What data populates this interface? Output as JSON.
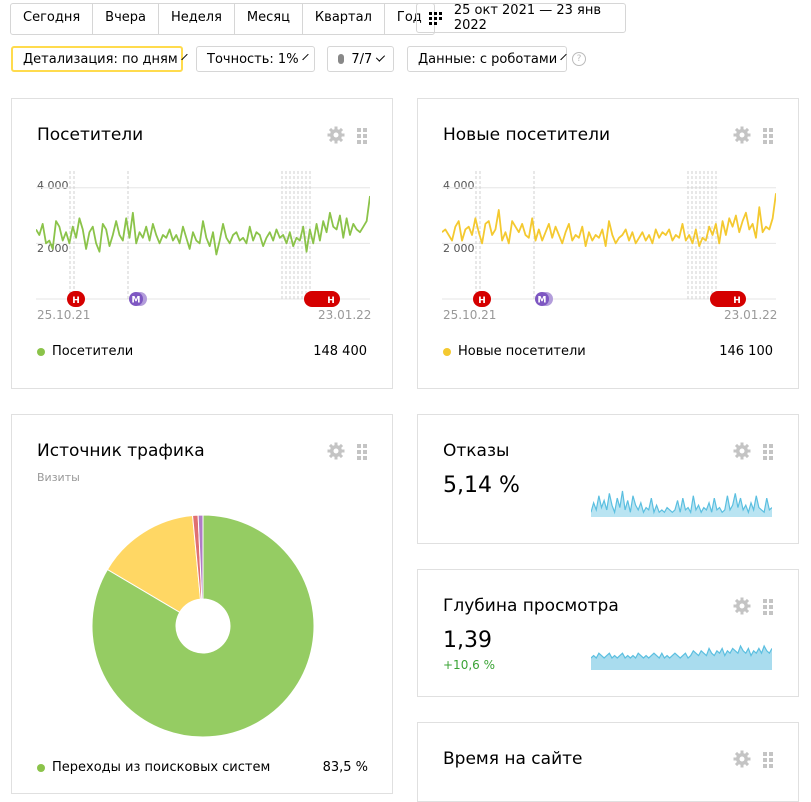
{
  "period_tabs": [
    "Сегодня",
    "Вчера",
    "Неделя",
    "Месяц",
    "Квартал",
    "Год"
  ],
  "date_range": "25 окт 2021 — 23 янв 2022",
  "toolbar": {
    "detail": "Детализация: по дням",
    "accuracy": "Точность: 1%",
    "comments": "7/7",
    "data": "Данные: с роботами",
    "help": "?"
  },
  "colors": {
    "green": "#8bc34a",
    "yellow": "#f4c930",
    "red": "#d50000",
    "purple": "#7e57c2",
    "blue": "#5bc0de"
  },
  "visitors": {
    "title": "Посетители",
    "y_ticks": [
      "4 000",
      "2 000"
    ],
    "date_start": "25.10.21",
    "date_end": "23.01.22",
    "legend": "Посетители",
    "total": "148 400"
  },
  "new_visitors": {
    "title": "Новые посетители",
    "y_ticks": [
      "4 000",
      "2 000"
    ],
    "date_start": "25.10.21",
    "date_end": "23.01.22",
    "legend": "Новые посетители",
    "total": "146 100"
  },
  "traffic": {
    "title": "Источник трафика",
    "subtitle": "Визиты",
    "legend_label": "Переходы из поисковых систем",
    "legend_value": "83,5 %"
  },
  "bounces": {
    "title": "Отказы",
    "value": "5,14 %"
  },
  "depth": {
    "title": "Глубина просмотра",
    "value": "1,39",
    "delta": "+10,6 %"
  },
  "time": {
    "title": "Время на сайте"
  },
  "markers": {
    "holiday": "Н",
    "m": "М"
  },
  "chart_data": [
    {
      "type": "line",
      "series": [
        {
          "name": "Посетители",
          "values": [
            2500,
            2300,
            2700,
            2000,
            2100,
            1800,
            2800,
            2600,
            2100,
            2400,
            2000,
            2600,
            2200,
            2900,
            2500,
            1800,
            2400,
            2600,
            2000,
            1700,
            2700,
            2500,
            1900,
            2300,
            2800,
            2300,
            2100,
            2900,
            2200,
            3100,
            2000,
            2400,
            2200,
            2600,
            2100,
            2700,
            2300,
            2000,
            2300,
            2200,
            2500,
            2100,
            2300,
            2000,
            2600,
            2200,
            1800,
            2400,
            2100,
            2000,
            2800,
            2200,
            1900,
            2400,
            1600,
            2100,
            2700,
            2200,
            2000,
            2300,
            2400,
            2100,
            2200,
            2000,
            2600,
            2100,
            2400,
            2300,
            1900,
            2200,
            2400,
            2100,
            2500,
            2200,
            2300,
            2000,
            2400,
            1900,
            2200,
            2100,
            2600,
            1700,
            2500,
            2000,
            2700,
            2100,
            2800,
            2400,
            3100,
            2600,
            2500,
            3000,
            2200,
            2900,
            2300,
            2700,
            2500,
            2400,
            2600,
            2800,
            3700
          ]
        }
      ],
      "ylim": [
        0,
        4600
      ]
    },
    {
      "type": "line",
      "series": [
        {
          "name": "Новые посетители",
          "values": [
            2400,
            2500,
            2300,
            2100,
            2600,
            2800,
            2100,
            2500,
            2600,
            2300,
            2900,
            2400,
            2000,
            2700,
            2800,
            2300,
            2500,
            3200,
            2100,
            2400,
            2000,
            2800,
            2600,
            2400,
            2700,
            2300,
            2200,
            2900,
            2100,
            2500,
            2100,
            2400,
            2700,
            2200,
            2600,
            2300,
            2000,
            2400,
            2700,
            2100,
            2300,
            2200,
            2600,
            1900,
            2400,
            2100,
            2300,
            2200,
            2500,
            1900,
            2800,
            2300,
            2000,
            2200,
            2300,
            2500,
            2100,
            2400,
            2000,
            2200,
            2400,
            2100,
            2300,
            2000,
            2500,
            2200,
            2400,
            2300,
            2500,
            2100,
            2300,
            2200,
            2700,
            2100,
            2300,
            2000,
            2500,
            1900,
            2200,
            2100,
            2600,
            2300,
            2700,
            2000,
            2800,
            2300,
            2900,
            2600,
            3000,
            2400,
            2800,
            3100,
            2500,
            2700,
            2200,
            3300,
            2400,
            2600,
            2500,
            2900,
            3800
          ]
        }
      ],
      "ylim": [
        0,
        4600
      ]
    },
    {
      "type": "pie",
      "slices": [
        {
          "label": "Переходы из поисковых систем",
          "value": 83.5
        },
        {
          "label": "",
          "value": 15.0
        },
        {
          "label": "",
          "value": 0.8
        },
        {
          "label": "",
          "value": 0.7
        }
      ]
    },
    {
      "type": "area",
      "series": [
        {
          "name": "Отказы",
          "values": [
            2,
            6,
            3,
            9,
            4,
            7,
            3,
            10,
            5,
            2,
            8,
            4,
            11,
            3,
            7,
            2,
            9,
            5,
            3,
            6,
            2,
            4,
            3,
            8,
            2,
            5,
            2,
            3,
            2,
            4,
            3,
            2,
            3,
            7,
            2,
            8,
            3,
            4,
            2,
            9,
            3,
            5,
            2,
            4,
            3,
            6,
            2,
            8,
            3,
            4,
            2,
            3,
            9,
            3,
            5,
            10,
            4,
            8,
            3,
            5,
            2,
            6,
            3,
            9,
            4,
            3,
            2,
            8,
            3,
            4
          ]
        }
      ]
    },
    {
      "type": "area",
      "series": [
        {
          "name": "Глубина просмотра",
          "values": [
            5,
            6,
            5,
            7,
            6,
            5,
            6,
            7,
            5,
            6,
            5,
            6,
            7,
            5,
            6,
            5,
            6,
            5,
            7,
            6,
            5,
            6,
            5,
            6,
            7,
            6,
            5,
            7,
            5,
            6,
            5,
            6,
            7,
            6,
            5,
            6,
            7,
            5,
            6,
            8,
            7,
            6,
            8,
            7,
            6,
            9,
            7,
            6,
            8,
            7,
            9,
            6,
            8,
            7,
            9,
            8,
            7,
            10,
            8,
            7,
            9,
            6,
            8,
            7,
            9,
            7,
            10,
            8,
            7,
            9
          ]
        }
      ]
    }
  ]
}
